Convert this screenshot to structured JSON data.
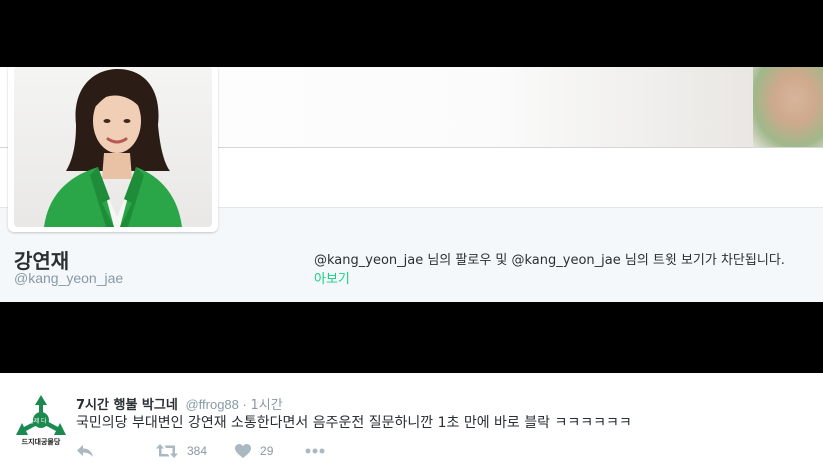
{
  "profile": {
    "name": "강연재",
    "handle": "@kang_yeon_jae",
    "block_notice": "@kang_yeon_jae 님의 팔로우 및 @kang_yeon_jae 님의 트윗 보기가 차단됩니다.",
    "view_link": "아보기"
  },
  "tweet": {
    "display_name": "7시간 행불 박그네",
    "handle": "@ffrog88",
    "separator": "·",
    "time": "1시간",
    "text": "국민의당 부대변인 강연재 소통한다면서 음주운전 질문하니깐 1초 만에 바로 블락 ㅋㅋㅋㅋㅋㅋ",
    "avatar_logo_text": "언제 다 해",
    "avatar_caption": "드지대궁물당",
    "retweets": "384",
    "likes": "29"
  },
  "icons": {
    "reply": "reply-icon",
    "retweet": "retweet-icon",
    "like": "heart-icon",
    "more": "more-icon"
  },
  "colors": {
    "link_green": "#19cf86",
    "text": "#292f33",
    "muted": "#8899a6",
    "logo_green": "#1b8a4f"
  }
}
